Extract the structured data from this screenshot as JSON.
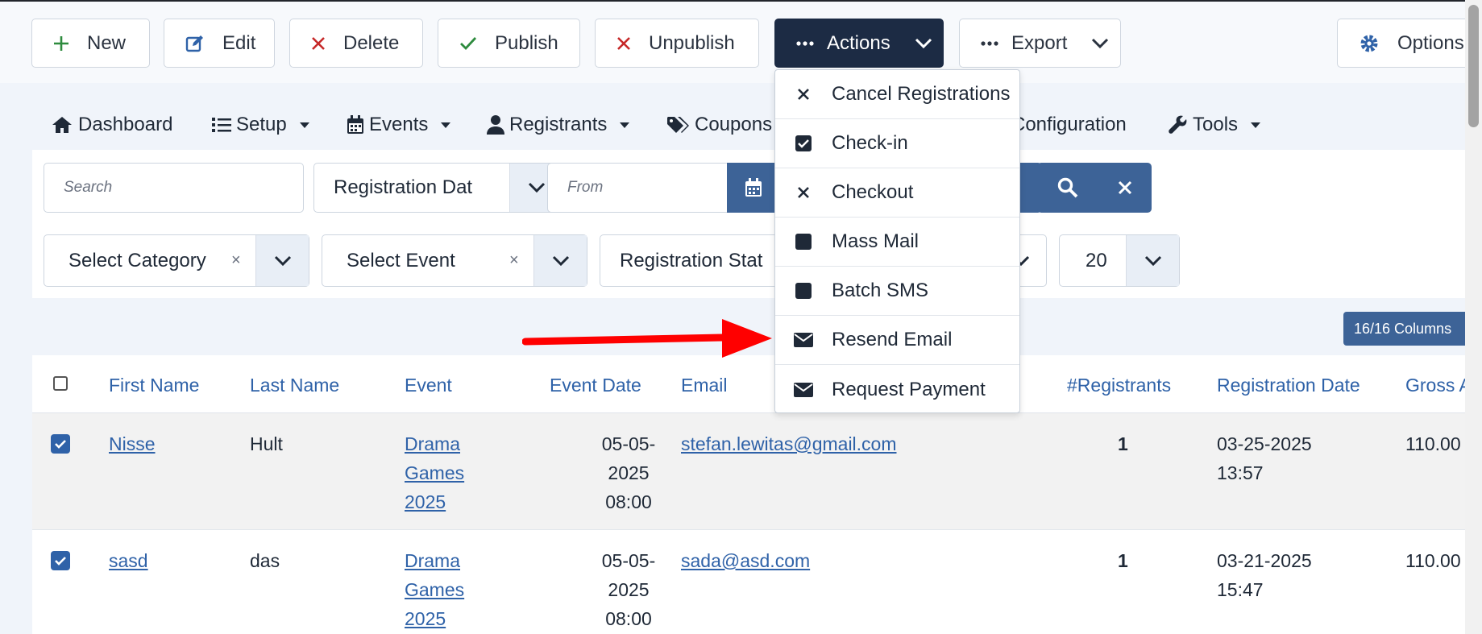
{
  "toolbar": {
    "new": "New",
    "edit": "Edit",
    "delete": "Delete",
    "publish": "Publish",
    "unpublish": "Unpublish",
    "actions": "Actions",
    "export": "Export",
    "options": "Options"
  },
  "nav": {
    "dashboard": "Dashboard",
    "setup": "Setup",
    "events": "Events",
    "registrants": "Registrants",
    "coupons": "Coupons",
    "configuration": "Configuration",
    "tools": "Tools"
  },
  "filters": {
    "search_placeholder": "Search",
    "date_type": "Registration Dat",
    "from_placeholder": "From",
    "category": "Select Category",
    "event": "Select Event",
    "status": "Registration Stat",
    "limit": "20"
  },
  "columns_button": "16/16 Columns",
  "actions_menu": [
    {
      "label": "Cancel Registrations",
      "icon": "times-icon"
    },
    {
      "label": "Check-in",
      "icon": "checkbox-icon"
    },
    {
      "label": "Checkout",
      "icon": "times-icon"
    },
    {
      "label": "Mass Mail",
      "icon": "square-icon"
    },
    {
      "label": "Batch SMS",
      "icon": "square-icon"
    },
    {
      "label": "Resend Email",
      "icon": "envelope-icon"
    },
    {
      "label": "Request Payment",
      "icon": "envelope-icon"
    }
  ],
  "table": {
    "headers": [
      "First Name",
      "Last Name",
      "Event",
      "Event Date",
      "Email",
      "#Registrants",
      "Registration Date",
      "Gross A"
    ],
    "rows": [
      {
        "first_name": "Nisse",
        "last_name": "Hult",
        "event": [
          "Drama",
          "Games",
          "2025"
        ],
        "event_date": [
          "05-05-",
          "2025",
          "08:00"
        ],
        "email": "stefan.lewitas@gmail.com",
        "registrants": "1",
        "registration_date": [
          "03-25-2025",
          "13:57"
        ],
        "gross": "110.00"
      },
      {
        "first_name": "sasd",
        "last_name": "das",
        "event": [
          "Drama",
          "Games",
          "2025"
        ],
        "event_date": [
          "05-05-",
          "2025",
          "08:00"
        ],
        "email": "sada@asd.com",
        "registrants": "1",
        "registration_date": [
          "03-21-2025",
          "15:47"
        ],
        "gross": "110.00"
      }
    ]
  },
  "colors": {
    "dark_button": "#1c2b44",
    "link_blue": "#2f62a8",
    "filter_blue": "#3d6397",
    "arrow_red": "#ff0000"
  }
}
